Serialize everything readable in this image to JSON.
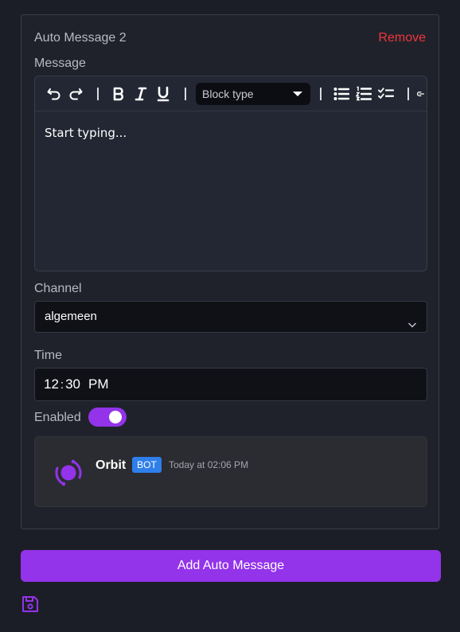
{
  "card": {
    "title": "Auto Message 2",
    "remove_label": "Remove",
    "message_label": "Message",
    "channel_label": "Channel",
    "time_label": "Time",
    "enabled_label": "Enabled"
  },
  "editor": {
    "block_type_placeholder": "Block type",
    "body_placeholder": "Start typing...",
    "toolbar_icons": [
      "undo-icon",
      "redo-icon",
      "bold-icon",
      "italic-icon",
      "underline-icon",
      "bullet-list-icon",
      "numbered-list-icon",
      "checklist-icon",
      "link-icon"
    ]
  },
  "channel": {
    "value": "algemeen"
  },
  "time": {
    "hour": "12",
    "separator": ":",
    "minute": "30",
    "period": "PM"
  },
  "enabled": {
    "value": true
  },
  "preview": {
    "author": "Orbit",
    "badge": "BOT",
    "timestamp": "Today at 02:06 PM"
  },
  "footer": {
    "add_button_label": "Add Auto Message",
    "save_icon": "save-icon"
  },
  "colors": {
    "accent": "#9333ea",
    "remove": "#f0353b",
    "badge": "#2f7fea",
    "background": "#1c1e27"
  }
}
